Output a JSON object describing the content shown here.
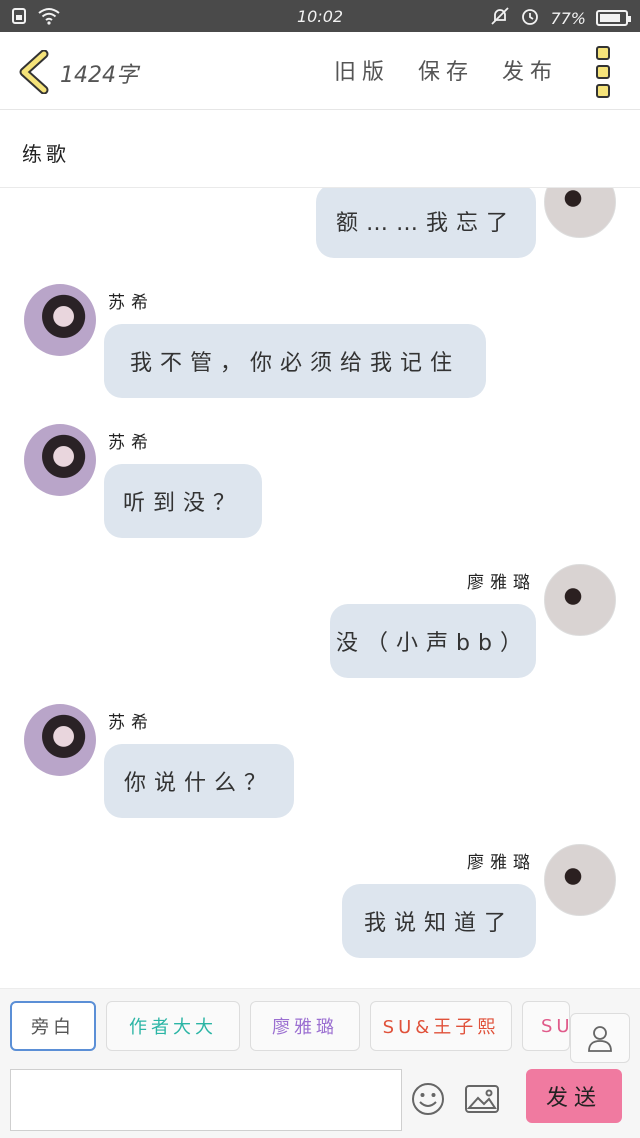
{
  "status_bar": {
    "time": "10:02",
    "battery": "77%",
    "battery_level": 0.77
  },
  "header": {
    "word_count": "1424字",
    "buttons": [
      "旧版",
      "保存",
      "发布"
    ]
  },
  "story": {
    "title": "练歌"
  },
  "messages": [
    {
      "side": "right",
      "sender": "",
      "text": "额……我忘了",
      "avatar": "boy"
    },
    {
      "side": "left",
      "sender": "苏希",
      "text": "我不管，你必须给我记住",
      "avatar": "girl"
    },
    {
      "side": "left",
      "sender": "苏希",
      "text": "听到没？",
      "avatar": "girl"
    },
    {
      "side": "right",
      "sender": "廖雅璐",
      "text": "没（小声bb）",
      "avatar": "boy"
    },
    {
      "side": "left",
      "sender": "苏希",
      "text": "你说什么？",
      "avatar": "girl"
    },
    {
      "side": "right",
      "sender": "廖雅璐",
      "text": "我说知道了",
      "avatar": "boy"
    }
  ],
  "roles": [
    {
      "label": "旁白",
      "color": "#555555",
      "selected": true
    },
    {
      "label": "作者大大",
      "color": "#2bb5a5",
      "selected": false
    },
    {
      "label": "廖雅璐",
      "color": "#9b6fd1",
      "selected": false
    },
    {
      "label": "SU&王子熙",
      "color": "#e0513a",
      "selected": false
    },
    {
      "label": "SU&",
      "color": "#e05a8a",
      "selected": false
    }
  ],
  "composer": {
    "input_value": "",
    "send_label": "发送"
  },
  "colors": {
    "bubble": "#dde5ee",
    "send": "#f07aa0",
    "accent": "#f5e37a"
  }
}
